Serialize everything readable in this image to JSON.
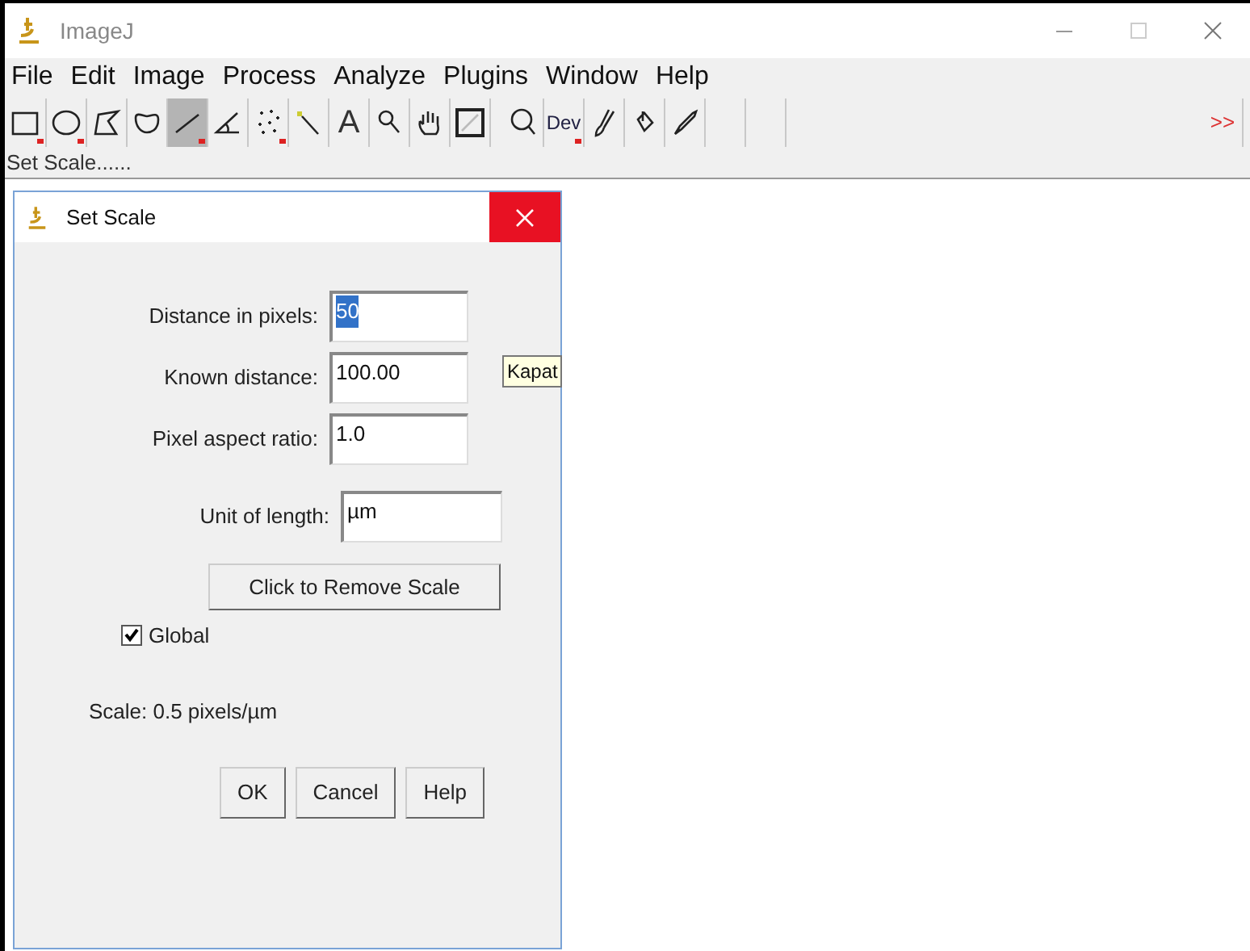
{
  "window": {
    "title": "ImageJ"
  },
  "menu": [
    {
      "label": "File"
    },
    {
      "label": "Edit"
    },
    {
      "label": "Image"
    },
    {
      "label": "Process"
    },
    {
      "label": "Analyze"
    },
    {
      "label": "Plugins"
    },
    {
      "label": "Window"
    },
    {
      "label": "Help"
    }
  ],
  "toolbar": [
    {
      "kind": "rectangle",
      "selected": false,
      "dropdown": true
    },
    {
      "kind": "oval",
      "selected": false,
      "dropdown": true
    },
    {
      "kind": "polygon",
      "selected": false,
      "dropdown": false
    },
    {
      "kind": "freehand",
      "selected": false,
      "dropdown": false
    },
    {
      "kind": "line",
      "selected": true,
      "dropdown": true
    },
    {
      "kind": "angle",
      "selected": false,
      "dropdown": false
    },
    {
      "kind": "points",
      "selected": false,
      "dropdown": true
    },
    {
      "kind": "wand",
      "selected": false,
      "dropdown": false
    },
    {
      "kind": "text",
      "selected": false,
      "dropdown": false,
      "label": "A"
    },
    {
      "kind": "magnifier",
      "selected": false,
      "dropdown": false
    },
    {
      "kind": "hand",
      "selected": false,
      "dropdown": false
    },
    {
      "kind": "dropper",
      "selected": false,
      "dropdown": false
    },
    {
      "kind": "spacer"
    },
    {
      "kind": "zoom",
      "selected": false,
      "dropdown": false
    },
    {
      "kind": "dev",
      "selected": false,
      "dropdown": true,
      "label": "Dev"
    },
    {
      "kind": "brush",
      "selected": false,
      "dropdown": false
    },
    {
      "kind": "bucket",
      "selected": false,
      "dropdown": false
    },
    {
      "kind": "pen",
      "selected": false,
      "dropdown": false
    },
    {
      "kind": "blank",
      "selected": false,
      "dropdown": false
    },
    {
      "kind": "blank",
      "selected": false,
      "dropdown": false
    },
    {
      "kind": "more",
      "selected": false,
      "dropdown": false,
      "label": ">>"
    }
  ],
  "status_bar": "Set Scale......",
  "dialog": {
    "title": "Set Scale",
    "close_tooltip": "Kapat",
    "fields": [
      {
        "label": "Distance in pixels:",
        "value": "50",
        "highlighted": true,
        "wide": false
      },
      {
        "label": "Known distance:",
        "value": "100.00",
        "highlighted": false,
        "wide": false
      },
      {
        "label": "Pixel aspect ratio:",
        "value": "1.0",
        "highlighted": false,
        "wide": false
      },
      {
        "label": "Unit of length:",
        "value": "µm",
        "highlighted": false,
        "wide": true
      }
    ],
    "remove_button": "Click to Remove Scale",
    "global": {
      "label": "Global",
      "checked": true
    },
    "scale_text": "Scale: 0.5 pixels/µm",
    "buttons": [
      "OK",
      "Cancel",
      "Help"
    ]
  }
}
